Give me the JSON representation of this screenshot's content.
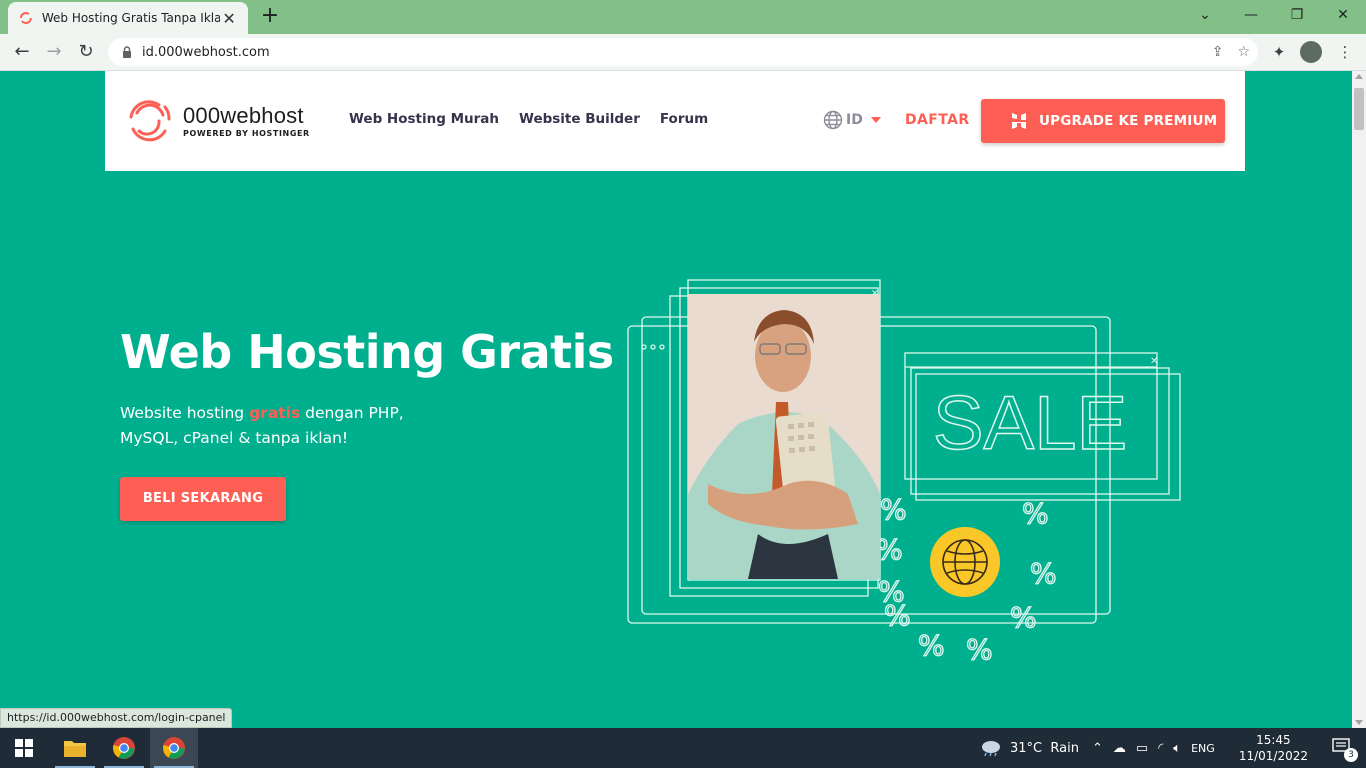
{
  "browser": {
    "tab_title": "Web Hosting Gratis Tanpa Iklan -",
    "tab_close": "✕",
    "new_tab": "+",
    "url": "id.000webhost.com",
    "status_url": "https://id.000webhost.com/login-cpanel"
  },
  "header": {
    "logo_name": "000webhost",
    "logo_sub": "POWERED BY HOSTINGER",
    "nav": [
      "Web Hosting Murah",
      "Website Builder",
      "Forum"
    ],
    "lang": "ID",
    "signup": "DAFTAR",
    "premium": "UPGRADE KE PREMIUM"
  },
  "hero": {
    "title": "Web Hosting Gratis",
    "sub_before": "Website hosting ",
    "sub_highlight": "gratis",
    "sub_after": " dengan PHP, MySQL, cPanel & tanpa iklan!",
    "cta": "BELI SEKARANG"
  },
  "illustration": {
    "sale_text": "SALE",
    "percent_glyph": "%"
  },
  "taskbar": {
    "weather": "31°C  Rain",
    "lang": "ENG",
    "time": "15:45",
    "date": "11/01/2022",
    "notifications": "3"
  },
  "colors": {
    "brand_green": "#00af8e",
    "accent_red": "#fe5f55",
    "globe_yellow": "#f9c828"
  }
}
